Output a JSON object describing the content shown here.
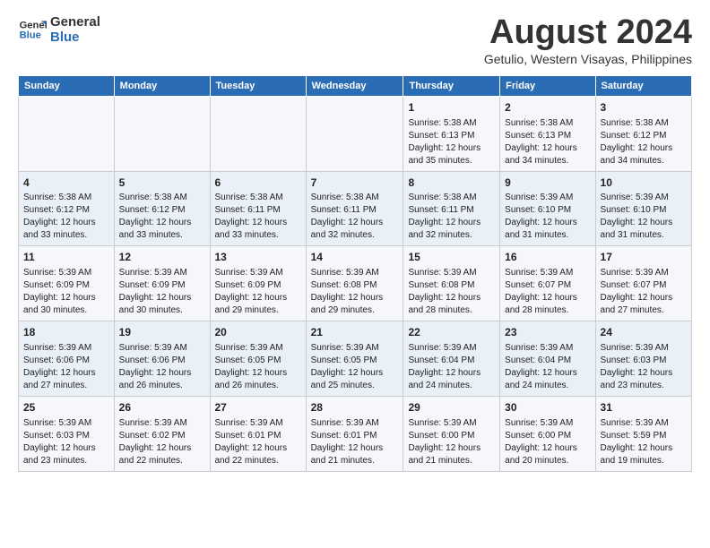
{
  "logo": {
    "line1": "General",
    "line2": "Blue"
  },
  "title": "August 2024",
  "subtitle": "Getulio, Western Visayas, Philippines",
  "days_of_week": [
    "Sunday",
    "Monday",
    "Tuesday",
    "Wednesday",
    "Thursday",
    "Friday",
    "Saturday"
  ],
  "weeks": [
    [
      {
        "day": "",
        "info": ""
      },
      {
        "day": "",
        "info": ""
      },
      {
        "day": "",
        "info": ""
      },
      {
        "day": "",
        "info": ""
      },
      {
        "day": "1",
        "info": "Sunrise: 5:38 AM\nSunset: 6:13 PM\nDaylight: 12 hours\nand 35 minutes."
      },
      {
        "day": "2",
        "info": "Sunrise: 5:38 AM\nSunset: 6:13 PM\nDaylight: 12 hours\nand 34 minutes."
      },
      {
        "day": "3",
        "info": "Sunrise: 5:38 AM\nSunset: 6:12 PM\nDaylight: 12 hours\nand 34 minutes."
      }
    ],
    [
      {
        "day": "4",
        "info": "Sunrise: 5:38 AM\nSunset: 6:12 PM\nDaylight: 12 hours\nand 33 minutes."
      },
      {
        "day": "5",
        "info": "Sunrise: 5:38 AM\nSunset: 6:12 PM\nDaylight: 12 hours\nand 33 minutes."
      },
      {
        "day": "6",
        "info": "Sunrise: 5:38 AM\nSunset: 6:11 PM\nDaylight: 12 hours\nand 33 minutes."
      },
      {
        "day": "7",
        "info": "Sunrise: 5:38 AM\nSunset: 6:11 PM\nDaylight: 12 hours\nand 32 minutes."
      },
      {
        "day": "8",
        "info": "Sunrise: 5:38 AM\nSunset: 6:11 PM\nDaylight: 12 hours\nand 32 minutes."
      },
      {
        "day": "9",
        "info": "Sunrise: 5:39 AM\nSunset: 6:10 PM\nDaylight: 12 hours\nand 31 minutes."
      },
      {
        "day": "10",
        "info": "Sunrise: 5:39 AM\nSunset: 6:10 PM\nDaylight: 12 hours\nand 31 minutes."
      }
    ],
    [
      {
        "day": "11",
        "info": "Sunrise: 5:39 AM\nSunset: 6:09 PM\nDaylight: 12 hours\nand 30 minutes."
      },
      {
        "day": "12",
        "info": "Sunrise: 5:39 AM\nSunset: 6:09 PM\nDaylight: 12 hours\nand 30 minutes."
      },
      {
        "day": "13",
        "info": "Sunrise: 5:39 AM\nSunset: 6:09 PM\nDaylight: 12 hours\nand 29 minutes."
      },
      {
        "day": "14",
        "info": "Sunrise: 5:39 AM\nSunset: 6:08 PM\nDaylight: 12 hours\nand 29 minutes."
      },
      {
        "day": "15",
        "info": "Sunrise: 5:39 AM\nSunset: 6:08 PM\nDaylight: 12 hours\nand 28 minutes."
      },
      {
        "day": "16",
        "info": "Sunrise: 5:39 AM\nSunset: 6:07 PM\nDaylight: 12 hours\nand 28 minutes."
      },
      {
        "day": "17",
        "info": "Sunrise: 5:39 AM\nSunset: 6:07 PM\nDaylight: 12 hours\nand 27 minutes."
      }
    ],
    [
      {
        "day": "18",
        "info": "Sunrise: 5:39 AM\nSunset: 6:06 PM\nDaylight: 12 hours\nand 27 minutes."
      },
      {
        "day": "19",
        "info": "Sunrise: 5:39 AM\nSunset: 6:06 PM\nDaylight: 12 hours\nand 26 minutes."
      },
      {
        "day": "20",
        "info": "Sunrise: 5:39 AM\nSunset: 6:05 PM\nDaylight: 12 hours\nand 26 minutes."
      },
      {
        "day": "21",
        "info": "Sunrise: 5:39 AM\nSunset: 6:05 PM\nDaylight: 12 hours\nand 25 minutes."
      },
      {
        "day": "22",
        "info": "Sunrise: 5:39 AM\nSunset: 6:04 PM\nDaylight: 12 hours\nand 24 minutes."
      },
      {
        "day": "23",
        "info": "Sunrise: 5:39 AM\nSunset: 6:04 PM\nDaylight: 12 hours\nand 24 minutes."
      },
      {
        "day": "24",
        "info": "Sunrise: 5:39 AM\nSunset: 6:03 PM\nDaylight: 12 hours\nand 23 minutes."
      }
    ],
    [
      {
        "day": "25",
        "info": "Sunrise: 5:39 AM\nSunset: 6:03 PM\nDaylight: 12 hours\nand 23 minutes."
      },
      {
        "day": "26",
        "info": "Sunrise: 5:39 AM\nSunset: 6:02 PM\nDaylight: 12 hours\nand 22 minutes."
      },
      {
        "day": "27",
        "info": "Sunrise: 5:39 AM\nSunset: 6:01 PM\nDaylight: 12 hours\nand 22 minutes."
      },
      {
        "day": "28",
        "info": "Sunrise: 5:39 AM\nSunset: 6:01 PM\nDaylight: 12 hours\nand 21 minutes."
      },
      {
        "day": "29",
        "info": "Sunrise: 5:39 AM\nSunset: 6:00 PM\nDaylight: 12 hours\nand 21 minutes."
      },
      {
        "day": "30",
        "info": "Sunrise: 5:39 AM\nSunset: 6:00 PM\nDaylight: 12 hours\nand 20 minutes."
      },
      {
        "day": "31",
        "info": "Sunrise: 5:39 AM\nSunset: 5:59 PM\nDaylight: 12 hours\nand 19 minutes."
      }
    ]
  ]
}
